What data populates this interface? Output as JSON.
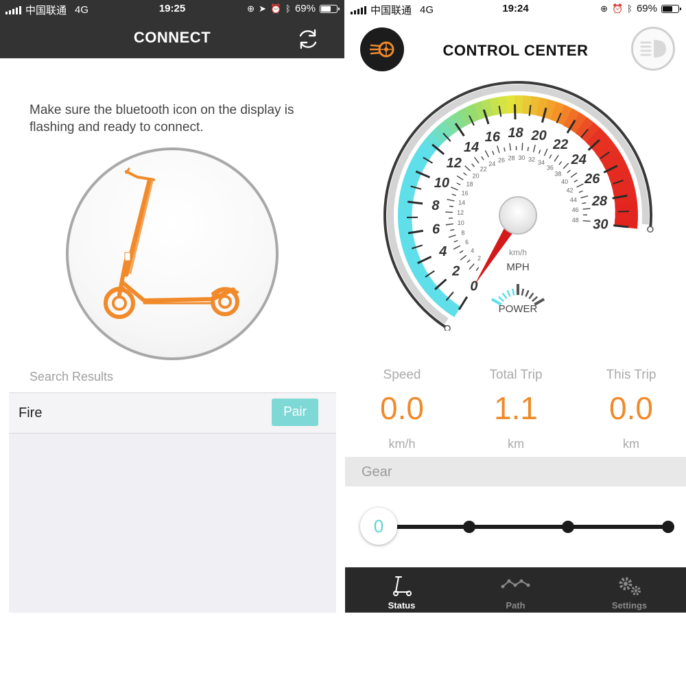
{
  "left": {
    "status": {
      "carrier": "中国联通",
      "network": "4G",
      "time": "19:25",
      "battery": "69%",
      "battery_level": 0.69
    },
    "title": "CONNECT",
    "instruction": "Make sure the bluetooth icon on the display is flashing and ready to connect.",
    "search_results_label": "Search Results",
    "results": [
      {
        "name": "Fire",
        "action": "Pair"
      }
    ],
    "colors": {
      "header": "#333333",
      "accent": "#7dd8d6",
      "scooter": "#f08a2b"
    }
  },
  "right": {
    "status": {
      "carrier": "中国联通",
      "network": "4G",
      "time": "19:24",
      "battery": "69%",
      "battery_level": 0.69
    },
    "title": "CONTROL CENTER",
    "gauge": {
      "mph_ticks": [
        "0",
        "2",
        "4",
        "6",
        "8",
        "10",
        "12",
        "14",
        "16",
        "18",
        "20",
        "22",
        "24",
        "26",
        "28",
        "30"
      ],
      "kmh_ticks": [
        "2",
        "4",
        "6",
        "8",
        "10",
        "12",
        "14",
        "16",
        "18",
        "20",
        "22",
        "24",
        "26",
        "28",
        "30",
        "32",
        "34",
        "36",
        "38",
        "40",
        "42",
        "44",
        "46",
        "48"
      ],
      "kmh_label": "km/h",
      "mph_label": "MPH",
      "power_label": "POWER",
      "speed_mph": 0,
      "speed_max_mph": 30
    },
    "stats": [
      {
        "label": "Speed",
        "value": "0.0",
        "unit": "km/h"
      },
      {
        "label": "Total Trip",
        "value": "1.1",
        "unit": "km"
      },
      {
        "label": "This Trip",
        "value": "0.0",
        "unit": "km"
      }
    ],
    "gear": {
      "label": "Gear",
      "value": "0",
      "levels": 4
    },
    "tabs": [
      {
        "label": "Status",
        "icon": "scooter-icon",
        "active": true
      },
      {
        "label": "Path",
        "icon": "path-icon",
        "active": false
      },
      {
        "label": "Settings",
        "icon": "gears-icon",
        "active": false
      }
    ],
    "colors": {
      "accent": "#f08a2b",
      "gear": "#63d3d3",
      "tabbar": "#292929"
    }
  }
}
